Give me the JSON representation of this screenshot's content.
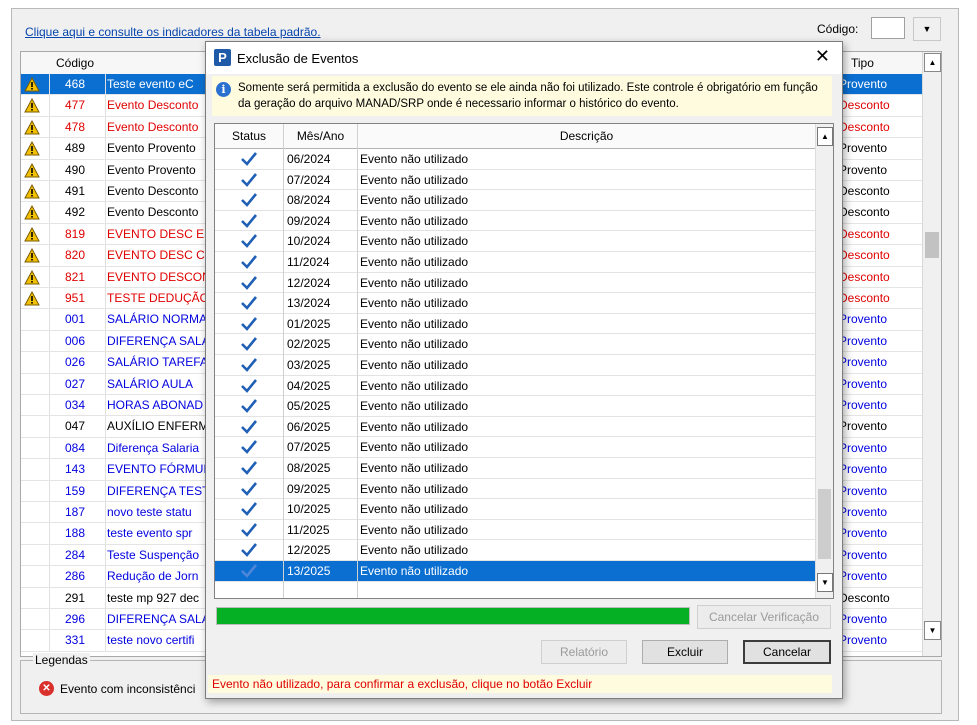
{
  "background": {
    "top_link": "Clique aqui e consulte os indicadores da tabela padrão.",
    "codigo_label": "Código:",
    "codigo_value": "",
    "table_headers": {
      "codigo": "Código",
      "tipo": "Tipo"
    },
    "rows": [
      {
        "warn": true,
        "codigo": "468",
        "descricao": "Teste evento eC",
        "tipo": "Provento",
        "color": "sel"
      },
      {
        "warn": true,
        "codigo": "477",
        "descricao": "Evento Desconto",
        "tipo": "Desconto",
        "color": "red"
      },
      {
        "warn": true,
        "codigo": "478",
        "descricao": "Evento Desconto",
        "tipo": "Desconto",
        "color": "red"
      },
      {
        "warn": true,
        "codigo": "489",
        "descricao": "Evento Provento",
        "tipo": "Provento",
        "color": "blk"
      },
      {
        "warn": true,
        "codigo": "490",
        "descricao": "Evento Provento",
        "tipo": "Provento",
        "color": "blk"
      },
      {
        "warn": true,
        "codigo": "491",
        "descricao": "Evento Desconto",
        "tipo": "Desconto",
        "color": "blk"
      },
      {
        "warn": true,
        "codigo": "492",
        "descricao": "Evento Desconto",
        "tipo": "Desconto",
        "color": "blk"
      },
      {
        "warn": true,
        "codigo": "819",
        "descricao": "EVENTO DESC ES",
        "tipo": "Desconto",
        "color": "red"
      },
      {
        "warn": true,
        "codigo": "820",
        "descricao": "EVENTO DESC CC",
        "tipo": "Desconto",
        "color": "red"
      },
      {
        "warn": true,
        "codigo": "821",
        "descricao": "EVENTO DESCON",
        "tipo": "Desconto",
        "color": "red"
      },
      {
        "warn": true,
        "codigo": "951",
        "descricao": "TESTE DEDUÇÃO",
        "tipo": "Desconto",
        "color": "red"
      },
      {
        "warn": false,
        "codigo": "001",
        "descricao": "SALÁRIO NORMA",
        "tipo": "Provento",
        "color": "blue"
      },
      {
        "warn": false,
        "codigo": "006",
        "descricao": "DIFERENÇA SALA",
        "tipo": "Provento",
        "color": "blue"
      },
      {
        "warn": false,
        "codigo": "026",
        "descricao": "SALÁRIO TAREFA",
        "tipo": "Provento",
        "color": "blue"
      },
      {
        "warn": false,
        "codigo": "027",
        "descricao": "SALÁRIO AULA",
        "tipo": "Provento",
        "color": "blue"
      },
      {
        "warn": false,
        "codigo": "034",
        "descricao": "HORAS ABONAD",
        "tipo": "Provento",
        "color": "blue"
      },
      {
        "warn": false,
        "codigo": "047",
        "descricao": "AUXÍLIO ENFERM",
        "tipo": "Provento",
        "color": "blk"
      },
      {
        "warn": false,
        "codigo": "084",
        "descricao": "Diferença Salaria",
        "tipo": "Provento",
        "color": "blue"
      },
      {
        "warn": false,
        "codigo": "143",
        "descricao": "EVENTO FÓRMUL",
        "tipo": "Provento",
        "color": "blue"
      },
      {
        "warn": false,
        "codigo": "159",
        "descricao": "DIFERENÇA TEST",
        "tipo": "Provento",
        "color": "blue"
      },
      {
        "warn": false,
        "codigo": "187",
        "descricao": "novo teste statu",
        "tipo": "Provento",
        "color": "blue"
      },
      {
        "warn": false,
        "codigo": "188",
        "descricao": "teste evento spr",
        "tipo": "Provento",
        "color": "blue"
      },
      {
        "warn": false,
        "codigo": "284",
        "descricao": "Teste Suspenção",
        "tipo": "Provento",
        "color": "blue"
      },
      {
        "warn": false,
        "codigo": "286",
        "descricao": "Redução de Jorn",
        "tipo": "Provento",
        "color": "blue"
      },
      {
        "warn": false,
        "codigo": "291",
        "descricao": "teste mp 927 dec",
        "tipo": "Desconto",
        "color": "blk"
      },
      {
        "warn": false,
        "codigo": "296",
        "descricao": "DIFERENÇA SALA",
        "tipo": "Provento",
        "color": "blue"
      },
      {
        "warn": false,
        "codigo": "331",
        "descricao": "teste novo certifi",
        "tipo": "Provento",
        "color": "blue"
      }
    ],
    "legend_title": "Legendas",
    "legend_item": "Evento com inconsistênci"
  },
  "dialog": {
    "title": "Exclusão de Eventos",
    "close_glyph": "✕",
    "info_text": "Somente será permitida a exclusão do evento se ele ainda não foi utilizado. Este controle é obrigatório em função da geração do arquivo  MANAD/SRP onde é  necessario informar o histórico do evento.",
    "headers": {
      "status": "Status",
      "mes_ano": "Mês/Ano",
      "descricao": "Descrição"
    },
    "rows": [
      {
        "mes_ano": "06/2024",
        "descricao": "Evento não utilizado"
      },
      {
        "mes_ano": "07/2024",
        "descricao": "Evento não utilizado"
      },
      {
        "mes_ano": "08/2024",
        "descricao": "Evento não utilizado"
      },
      {
        "mes_ano": "09/2024",
        "descricao": "Evento não utilizado"
      },
      {
        "mes_ano": "10/2024",
        "descricao": "Evento não utilizado"
      },
      {
        "mes_ano": "11/2024",
        "descricao": "Evento não utilizado"
      },
      {
        "mes_ano": "12/2024",
        "descricao": "Evento não utilizado"
      },
      {
        "mes_ano": "13/2024",
        "descricao": "Evento não utilizado"
      },
      {
        "mes_ano": "01/2025",
        "descricao": "Evento não utilizado"
      },
      {
        "mes_ano": "02/2025",
        "descricao": "Evento não utilizado"
      },
      {
        "mes_ano": "03/2025",
        "descricao": "Evento não utilizado"
      },
      {
        "mes_ano": "04/2025",
        "descricao": "Evento não utilizado"
      },
      {
        "mes_ano": "05/2025",
        "descricao": "Evento não utilizado"
      },
      {
        "mes_ano": "06/2025",
        "descricao": "Evento não utilizado"
      },
      {
        "mes_ano": "07/2025",
        "descricao": "Evento não utilizado"
      },
      {
        "mes_ano": "08/2025",
        "descricao": "Evento não utilizado"
      },
      {
        "mes_ano": "09/2025",
        "descricao": "Evento não utilizado"
      },
      {
        "mes_ano": "10/2025",
        "descricao": "Evento não utilizado"
      },
      {
        "mes_ano": "11/2025",
        "descricao": "Evento não utilizado"
      },
      {
        "mes_ano": "12/2025",
        "descricao": "Evento não utilizado"
      },
      {
        "mes_ano": "13/2025",
        "descricao": "Evento não utilizado",
        "selected": true
      }
    ],
    "progress": 1.0,
    "buttons": {
      "cancelar_verificacao": "Cancelar Verificação",
      "relatorio": "Relatório",
      "excluir": "Excluir",
      "cancelar": "Cancelar"
    },
    "status_message": "Evento não utilizado, para confirmar a exclusão, clique no botão Excluir"
  },
  "colors": {
    "selection": "#0a6fd1",
    "check": "#1f5fb5",
    "progress": "#06b025",
    "warning": "#f2c200",
    "error_text": "#e00000"
  }
}
